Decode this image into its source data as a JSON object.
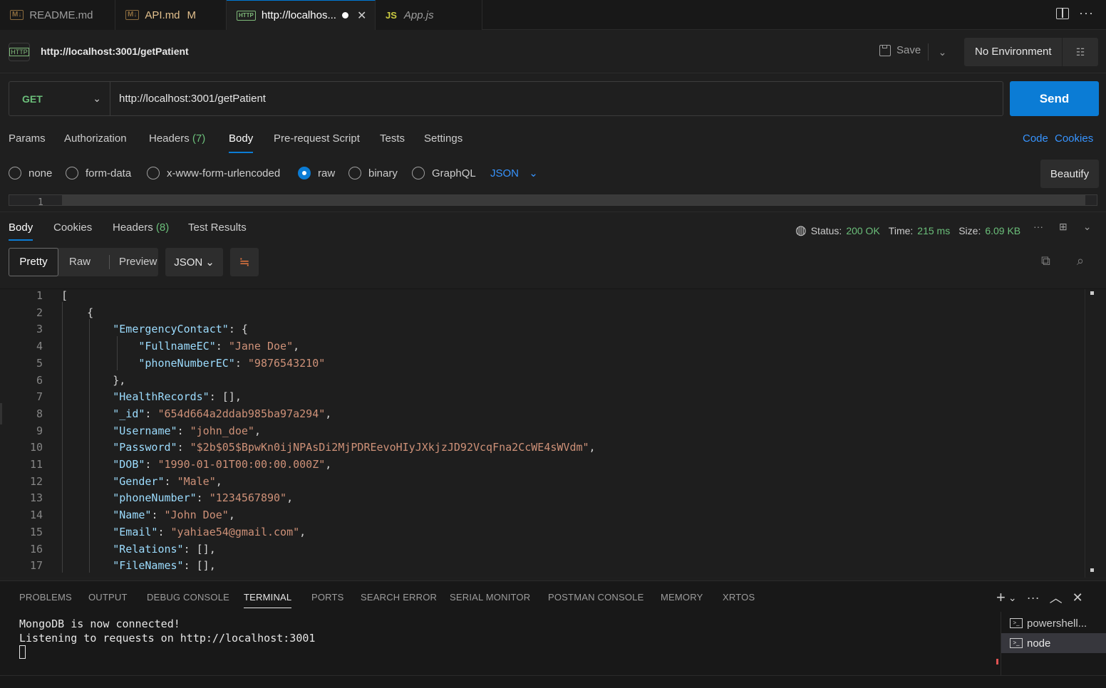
{
  "tabs": [
    {
      "label": "README.md",
      "icon": "M↓",
      "modified": ""
    },
    {
      "label": "API.md",
      "icon": "M↓",
      "modified": "M"
    },
    {
      "label": "http://localhos...",
      "icon": "HTTP",
      "modified": ""
    },
    {
      "label": "App.js",
      "icon": "JS",
      "modified": ""
    }
  ],
  "request": {
    "title": "http://localhost:3001/getPatient",
    "save_label": "Save",
    "environment": "No Environment",
    "method": "GET",
    "url": "http://localhost:3001/getPatient",
    "send_label": "Send",
    "tabs": {
      "params": "Params",
      "authorization": "Authorization",
      "headers": "Headers",
      "headers_count": "(7)",
      "body": "Body",
      "prerequest": "Pre-request Script",
      "tests": "Tests",
      "settings": "Settings"
    },
    "code_link": "Code",
    "cookies_link": "Cookies",
    "body_types": {
      "none": "none",
      "form_data": "form-data",
      "urlencoded": "x-www-form-urlencoded",
      "raw": "raw",
      "binary": "binary",
      "graphql": "GraphQL"
    },
    "body_format": "JSON",
    "beautify_label": "Beautify",
    "editor_line": "1"
  },
  "response": {
    "tabs": {
      "body": "Body",
      "cookies": "Cookies",
      "headers": "Headers",
      "headers_count": "(8)",
      "test_results": "Test Results"
    },
    "status_label": "Status:",
    "status_value": "200 OK",
    "time_label": "Time:",
    "time_value": "215 ms",
    "size_label": "Size:",
    "size_value": "6.09 KB",
    "views": {
      "pretty": "Pretty",
      "raw": "Raw",
      "preview": "Preview"
    },
    "format": "JSON",
    "lines": [
      {
        "n": "1",
        "t": "["
      },
      {
        "n": "2",
        "t": "    {"
      },
      {
        "n": "3",
        "t": "        \"EmergencyContact\": {"
      },
      {
        "n": "4",
        "t": "            \"FullnameEC\": \"Jane Doe\","
      },
      {
        "n": "5",
        "t": "            \"phoneNumberEC\": \"9876543210\""
      },
      {
        "n": "6",
        "t": "        },"
      },
      {
        "n": "7",
        "t": "        \"HealthRecords\": [],"
      },
      {
        "n": "8",
        "t": "        \"_id\": \"654d664a2ddab985ba97a294\","
      },
      {
        "n": "9",
        "t": "        \"Username\": \"john_doe\","
      },
      {
        "n": "10",
        "t": "        \"Password\": \"$2b$05$BpwKn0ijNPAsDi2MjPDREevoHIyJXkjzJD92VcqFna2CcWE4sWVdm\","
      },
      {
        "n": "11",
        "t": "        \"DOB\": \"1990-01-01T00:00:00.000Z\","
      },
      {
        "n": "12",
        "t": "        \"Gender\": \"Male\","
      },
      {
        "n": "13",
        "t": "        \"phoneNumber\": \"1234567890\","
      },
      {
        "n": "14",
        "t": "        \"Name\": \"John Doe\","
      },
      {
        "n": "15",
        "t": "        \"Email\": \"yahiae54@gmail.com\","
      },
      {
        "n": "16",
        "t": "        \"Relations\": [],"
      },
      {
        "n": "17",
        "t": "        \"FileNames\": [],"
      }
    ]
  },
  "panel": {
    "tabs": [
      "PROBLEMS",
      "OUTPUT",
      "DEBUG CONSOLE",
      "TERMINAL",
      "PORTS",
      "SEARCH ERROR",
      "SERIAL MONITOR",
      "POSTMAN CONSOLE",
      "MEMORY",
      "XRTOS"
    ],
    "active_tab": "TERMINAL",
    "terminal_output": "MongoDB is now connected!\nListening to requests on http://localhost:3001",
    "terminals": [
      "powershell...",
      "node"
    ]
  },
  "colors": {
    "accent": "#0b7cd5",
    "status_green": "#6bbf7a",
    "json_key": "#9cdcfe",
    "json_string": "#ce9178"
  }
}
